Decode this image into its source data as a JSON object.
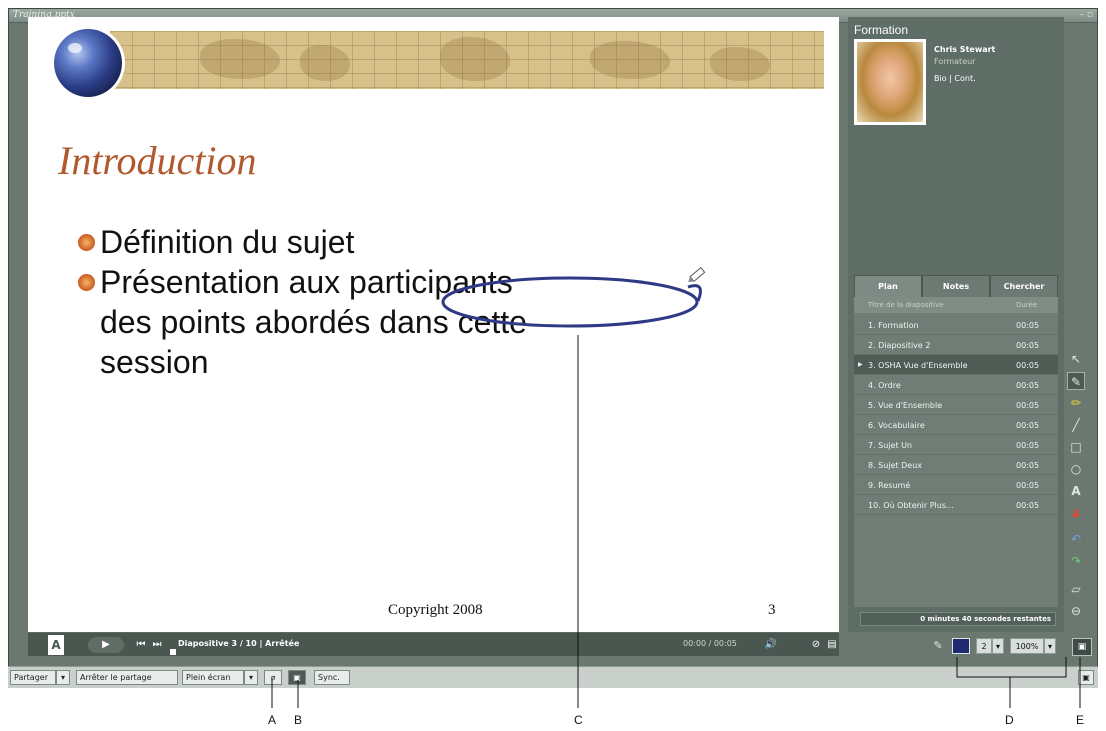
{
  "window": {
    "title": "Training.pptx",
    "controls": "– ▫"
  },
  "slide": {
    "title": "Introduction",
    "bullets": [
      "Définition du sujet",
      "Présentation aux participants des points abordés dans cette session"
    ],
    "bullet2_lines": [
      "Présentation aux participants",
      "des points abordés dans cette",
      "session"
    ],
    "copyright": "Copyright 2008",
    "page_number": "3"
  },
  "playbar": {
    "logo": "A",
    "play": "▶",
    "prev": "⏮",
    "next": "⏭",
    "status": "Diapositive 3 / 10 | Arrêtée",
    "time": "00:00 / 00:05",
    "volume_icon": "🔊",
    "attach_icon": "⊘",
    "more_icon": "▤"
  },
  "panel": {
    "title": "Formation",
    "presenter_name": "Chris Stewart",
    "presenter_role": "Formateur",
    "presenter_links": "Bio | Cont.",
    "tabs": [
      "Plan",
      "Notes",
      "Chercher"
    ],
    "outline_header": {
      "title": "Titre de la diapositive",
      "duration": "Durée"
    },
    "outline": [
      {
        "title": "1. Formation",
        "duration": "00:05"
      },
      {
        "title": "2. Diapositive 2",
        "duration": "00:05"
      },
      {
        "title": "3. OSHA Vue d'Ensemble",
        "duration": "00:05",
        "selected": true
      },
      {
        "title": "4. Ordre",
        "duration": "00:05"
      },
      {
        "title": "5. Vue d'Ensemble",
        "duration": "00:05"
      },
      {
        "title": "6. Vocabulaire",
        "duration": "00:05"
      },
      {
        "title": "7. Sujet Un",
        "duration": "00:05"
      },
      {
        "title": "8. Sujet Deux",
        "duration": "00:05"
      },
      {
        "title": "9. Resumé",
        "duration": "00:05"
      },
      {
        "title": "10. Où Obtenir Plus...",
        "duration": "00:05"
      }
    ],
    "remaining": "0 minutes 40 secondes restantes"
  },
  "annotation_toolbar": {
    "pencil": "✎",
    "size": "2",
    "zoom": "100%",
    "dropdown": "▾",
    "color": "#1f2a72"
  },
  "sharebar": {
    "share": "Partager",
    "stop_share": "Arrêter le partage",
    "fullscreen": "Plein écran",
    "dropdown": "▾",
    "sync": "Sync.",
    "a_icon": "⌀",
    "b_icon": "▣",
    "corner_icon": "▣"
  },
  "tools": [
    "↖",
    "✎",
    "✏",
    "╱",
    "□",
    "○",
    "A",
    "♟",
    "↶",
    "↷",
    "▱",
    "⊖"
  ],
  "callouts": [
    "A",
    "B",
    "C",
    "D",
    "E"
  ]
}
